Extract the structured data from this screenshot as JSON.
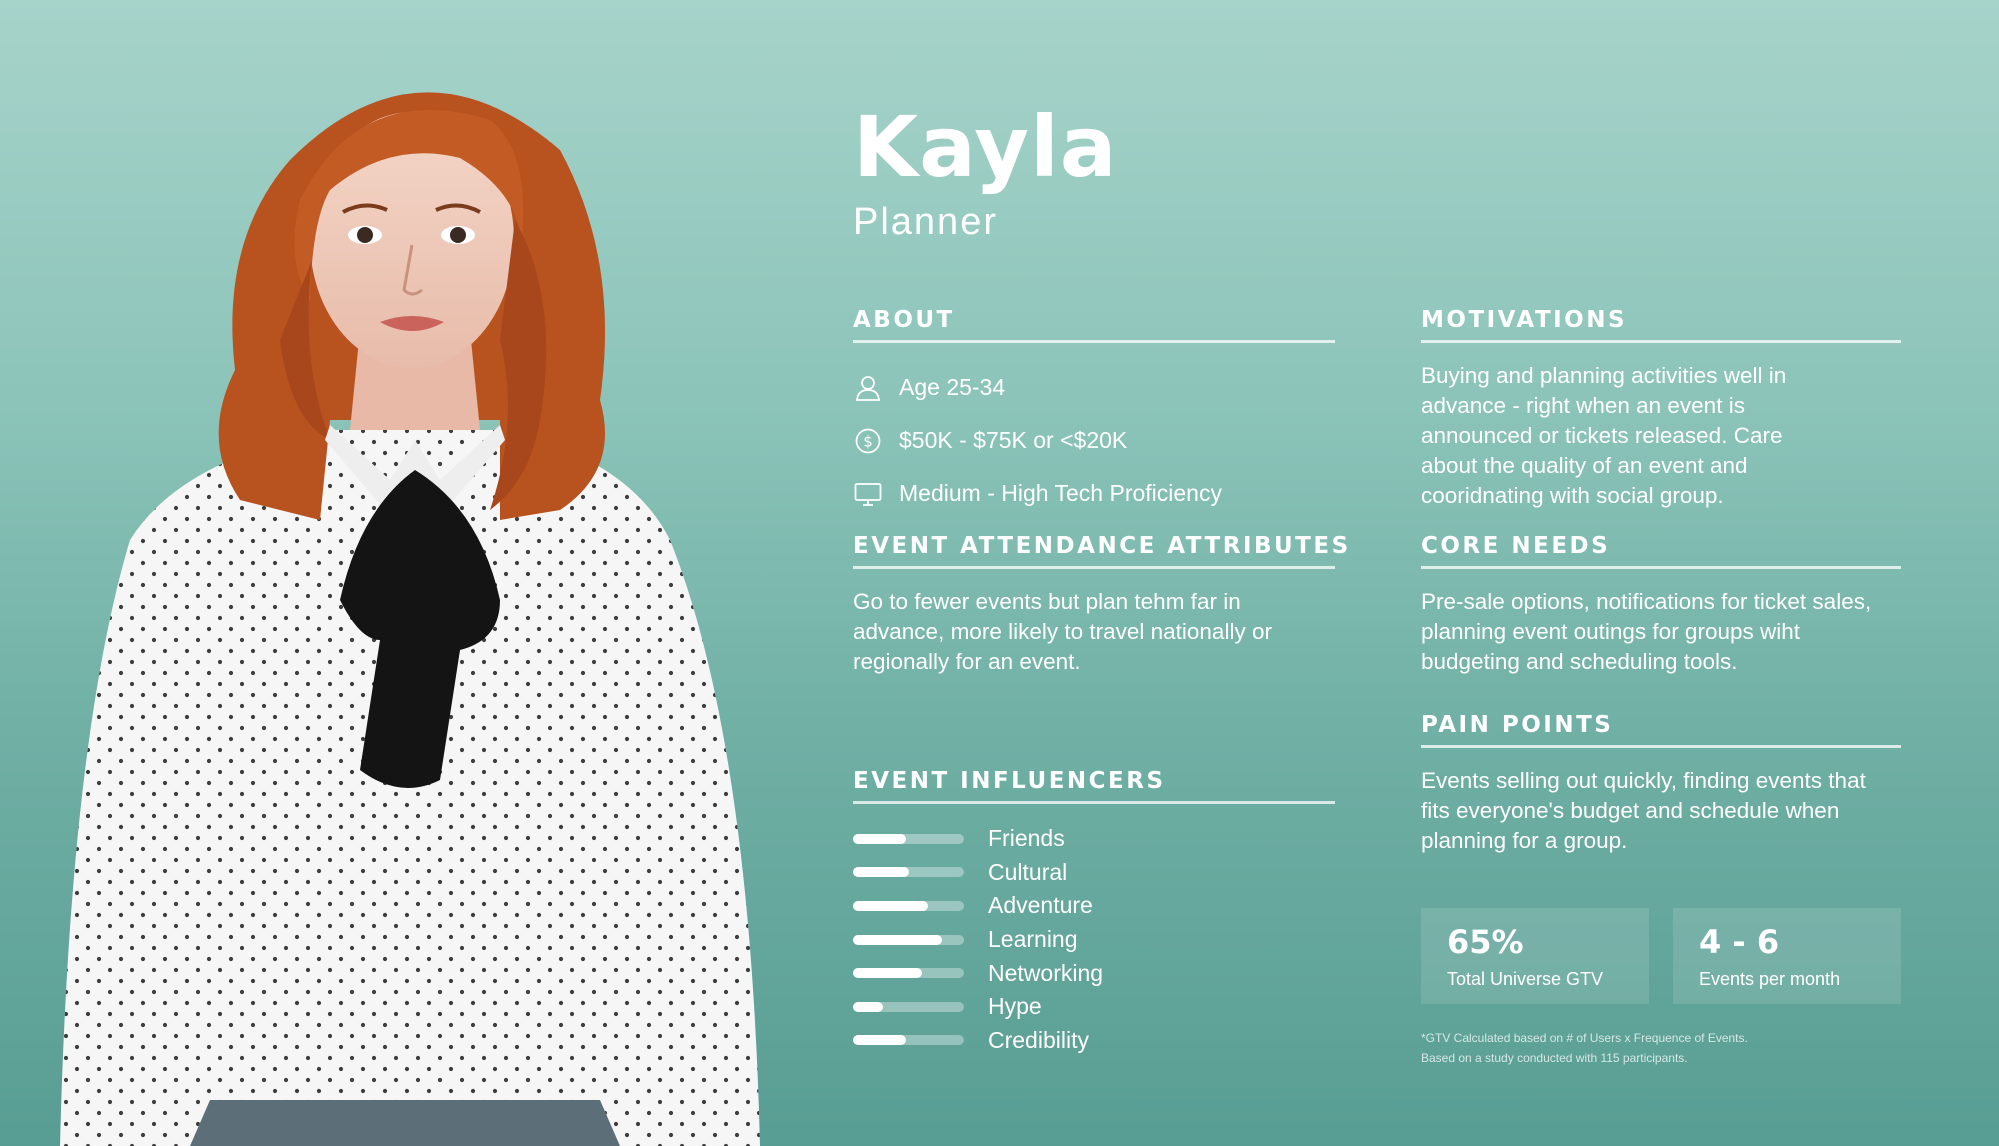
{
  "persona": {
    "name": "Kayla",
    "role": "Planner"
  },
  "about": {
    "title": "ABOUT",
    "items": [
      {
        "icon": "user-icon",
        "text": "Age 25-34"
      },
      {
        "icon": "dollar-icon",
        "text": "$50K - $75K or <$20K"
      },
      {
        "icon": "monitor-icon",
        "text": "Medium - High Tech Proficiency"
      }
    ]
  },
  "attendance": {
    "title": "EVENT ATTENDANCE ATTRIBUTES",
    "text": "Go to fewer events but plan tehm far in advance, more likely to travel nationally or regionally for an event."
  },
  "influencers": {
    "title": "EVENT INFLUENCERS",
    "items": [
      {
        "label": "Friends",
        "level": 0.48
      },
      {
        "label": "Cultural",
        "level": 0.5
      },
      {
        "label": "Adventure",
        "level": 0.68
      },
      {
        "label": "Learning",
        "level": 0.8
      },
      {
        "label": "Networking",
        "level": 0.62
      },
      {
        "label": "Hype",
        "level": 0.27
      },
      {
        "label": "Credibility",
        "level": 0.48
      }
    ]
  },
  "motivations": {
    "title": "MOTIVATIONS",
    "text": "Buying and planning activities well in advance - right when an event is announced or tickets released. Care about the quality of an event and cooridnating with social group."
  },
  "core_needs": {
    "title": "CORE NEEDS",
    "text": "Pre-sale options, notifications for ticket sales, planning event outings for groups wiht budgeting and scheduling tools."
  },
  "pain_points": {
    "title": "PAIN POINTS",
    "text": "Events selling out quickly, finding events that fits everyone's budget and schedule when planning for a group."
  },
  "stats": [
    {
      "value": "65%",
      "label": "Total Universe GTV"
    },
    {
      "value": "4 - 6",
      "label": "Events per month"
    }
  ],
  "footnote": {
    "line1": "*GTV Calculated based on # of Users x Frequence of Events.",
    "line2": "Based on a study conducted with 115 participants."
  },
  "colors": {
    "background_top": "#a6d3ca",
    "background_bottom": "#589d93",
    "text": "#ffffff"
  }
}
